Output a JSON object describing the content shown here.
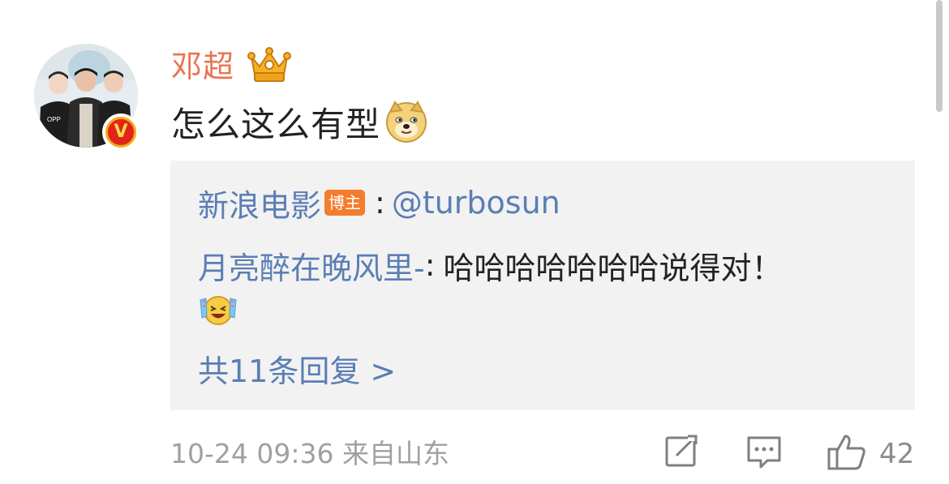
{
  "comment": {
    "username": "邓超",
    "text": "怎么这么有型",
    "emoji": "doge-emoji"
  },
  "reply": {
    "author": "新浪电影",
    "author_badge": "博主",
    "separator": ":",
    "mention": "@turbosun",
    "second_author": "月亮醉在晚风里-",
    "second_separator": ":",
    "second_text": "哈哈哈哈哈哈哈说得对！",
    "second_emoji": "laughing-tears-emoji",
    "more_label": "共11条回复 >"
  },
  "footer": {
    "time_source": "10-24 09:36  来自山东",
    "like_count": "42"
  },
  "icons": {
    "share": "share-edit-icon",
    "reply": "comment-icon",
    "like": "thumbs-up-icon"
  },
  "colors": {
    "username": "#eb7350",
    "link": "#5a7eb4",
    "badge": "#f47c2c",
    "reply_background": "#f2f2f2",
    "meta_gray": "#a0a0a0"
  }
}
